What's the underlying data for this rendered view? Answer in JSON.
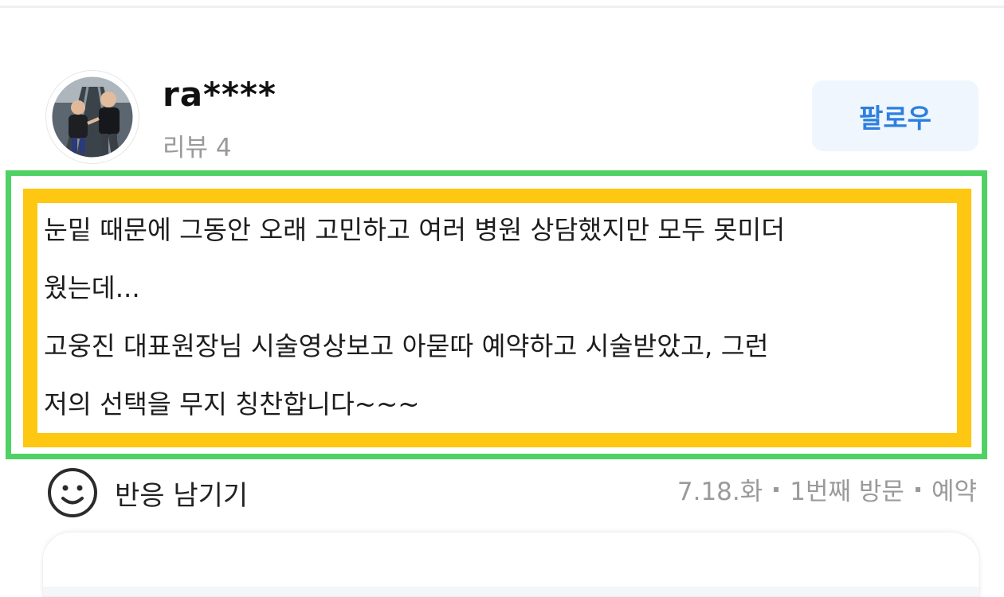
{
  "author": {
    "username": "ra****",
    "review_count": "리뷰 4",
    "avatar_icon": "profile-photo"
  },
  "follow_button": {
    "label": "팔로우",
    "color": "#2d7fe0",
    "background": "#eff6fd"
  },
  "highlight_colors": {
    "outer": "#4fd164",
    "inner": "#fec711"
  },
  "review": {
    "lines": [
      "눈밑 때문에 그동안 오래 고민하고 여러 병원 상담했지만 모두 못미더",
      "웠는데...",
      "고웅진 대표원장님 시술영상보고 아묻따 예약하고 시술받았고, 그런",
      "저의 선택을 무지 칭찬합니다~~~"
    ]
  },
  "reaction": {
    "icon": "smiley-icon",
    "label": "반응 남기기"
  },
  "meta": {
    "date": "7.18.화",
    "visit": "1번째 방문",
    "type": "예약"
  }
}
